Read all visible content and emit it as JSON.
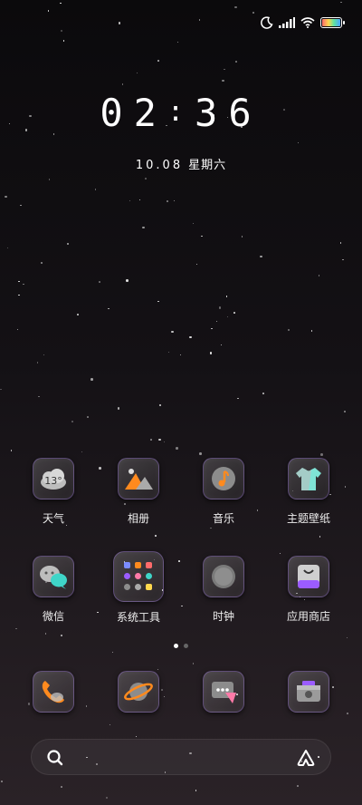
{
  "status_bar": {
    "icons": [
      "moon-icon",
      "signal-icon",
      "wifi-icon",
      "battery-icon"
    ]
  },
  "lock": {
    "hour": "02",
    "separator": ":",
    "minute": "36",
    "date": "10.08",
    "weekday": "星期六"
  },
  "apps_row1": [
    {
      "label": "天气",
      "icon": "weather-icon",
      "temp": "13°"
    },
    {
      "label": "相册",
      "icon": "gallery-icon"
    },
    {
      "label": "音乐",
      "icon": "music-icon"
    },
    {
      "label": "主题壁纸",
      "icon": "themes-icon"
    }
  ],
  "apps_row2": [
    {
      "label": "微信",
      "icon": "wechat-icon"
    },
    {
      "label": "系统工具",
      "icon": "system-tools-folder-icon"
    },
    {
      "label": "时钟",
      "icon": "clock-icon"
    },
    {
      "label": "应用商店",
      "icon": "app-store-icon"
    }
  ],
  "page_indicator": {
    "count": 2,
    "active": 0
  },
  "dock": [
    {
      "icon": "phone-icon"
    },
    {
      "icon": "browser-icon"
    },
    {
      "icon": "messages-icon"
    },
    {
      "icon": "camera-icon"
    }
  ],
  "searchbar": {
    "left_icon": "search-icon",
    "right_icon": "assistant-icon"
  },
  "colors": {
    "accent_orange": "#ff8a1e",
    "accent_teal": "#3fd5c8",
    "accent_purple": "#9b5cff",
    "accent_pink": "#ff7aa8"
  }
}
